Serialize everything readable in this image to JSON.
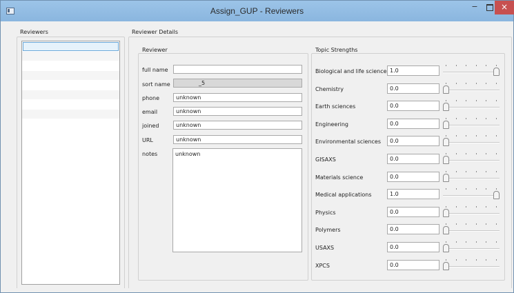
{
  "window": {
    "title": "Assign_GUP - Reviewers",
    "min_glyph": "−",
    "close_glyph": "×"
  },
  "reviewers_panel": {
    "label": "Reviewers",
    "rows": 9
  },
  "details": {
    "label": "Reviewer Details",
    "reviewer_label": "Reviewer",
    "fields": [
      {
        "label": "full name",
        "value": ""
      },
      {
        "label": "sort name",
        "value": "_5"
      },
      {
        "label": "phone",
        "value": "unknown"
      },
      {
        "label": "email",
        "value": "unknown"
      },
      {
        "label": "joined",
        "value": "unknown"
      },
      {
        "label": "URL",
        "value": "unknown"
      }
    ],
    "notes_label": "notes",
    "notes_value": "unknown"
  },
  "topics": {
    "label": "Topic Strengths",
    "items": [
      {
        "name": "Biological and life sciences",
        "value": "1.0",
        "level": 1.0
      },
      {
        "name": "Chemistry",
        "value": "0.0",
        "level": 0.0
      },
      {
        "name": "Earth sciences",
        "value": "0.0",
        "level": 0.0
      },
      {
        "name": "Engineering",
        "value": "0.0",
        "level": 0.0
      },
      {
        "name": "Environmental sciences",
        "value": "0.0",
        "level": 0.0
      },
      {
        "name": "GISAXS",
        "value": "0.0",
        "level": 0.0
      },
      {
        "name": "Materials science",
        "value": "0.0",
        "level": 0.0
      },
      {
        "name": "Medical applications",
        "value": "1.0",
        "level": 1.0
      },
      {
        "name": "Physics",
        "value": "0.0",
        "level": 0.0
      },
      {
        "name": "Polymers",
        "value": "0.0",
        "level": 0.0
      },
      {
        "name": "USAXS",
        "value": "0.0",
        "level": 0.0
      },
      {
        "name": "XPCS",
        "value": "0.0",
        "level": 0.0
      }
    ]
  }
}
